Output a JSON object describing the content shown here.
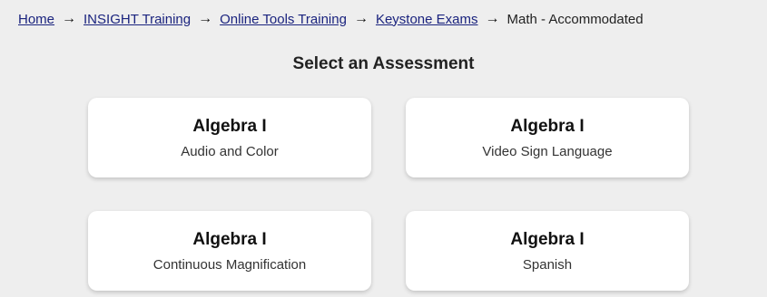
{
  "breadcrumb": {
    "items": [
      {
        "label": "Home"
      },
      {
        "label": "INSIGHT Training"
      },
      {
        "label": "Online Tools Training"
      },
      {
        "label": "Keystone Exams"
      }
    ],
    "separator": "→",
    "current": "Math - Accommodated"
  },
  "heading": "Select an Assessment",
  "cards": [
    {
      "title": "Algebra I",
      "subtitle": "Audio and Color"
    },
    {
      "title": "Algebra I",
      "subtitle": "Video Sign Language"
    },
    {
      "title": "Algebra I",
      "subtitle": "Continuous Magnification"
    },
    {
      "title": "Algebra I",
      "subtitle": "Spanish"
    }
  ],
  "colors": {
    "background": "#eeeeee",
    "card": "#ffffff",
    "link": "#1a237e"
  }
}
